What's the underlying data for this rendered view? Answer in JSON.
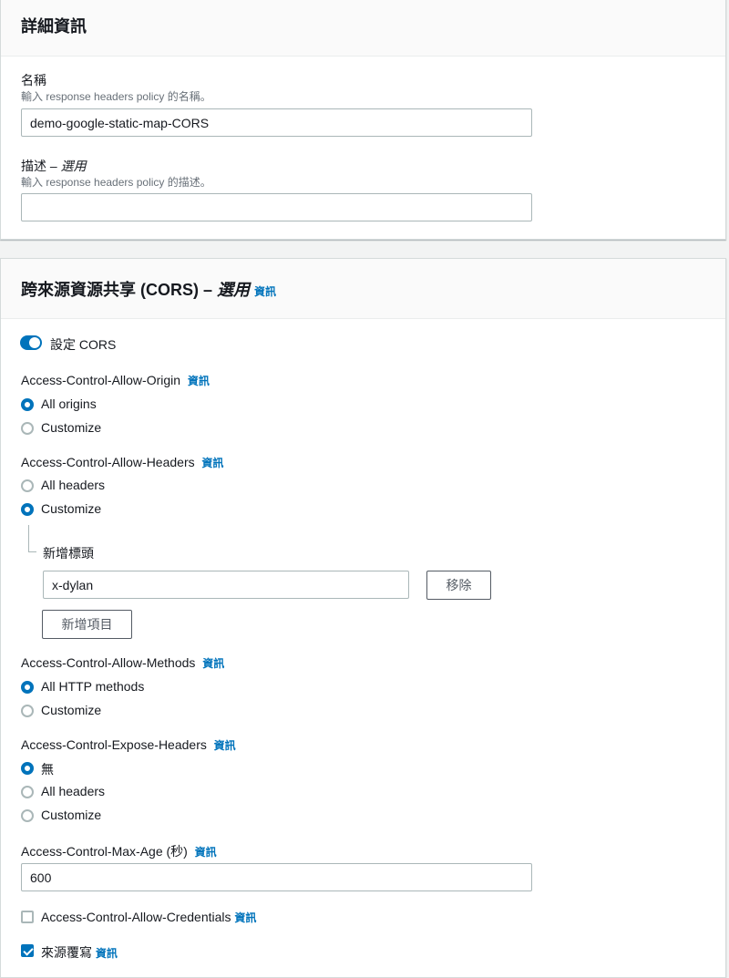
{
  "details": {
    "title": "詳細資訊",
    "name_label": "名稱",
    "name_desc": "輸入 response headers policy 的名稱。",
    "name_value": "demo-google-static-map-CORS",
    "desc_label": "描述 – ",
    "desc_optional": "選用",
    "desc_desc": "輸入 response headers policy 的描述。",
    "desc_value": ""
  },
  "cors": {
    "title": "跨來源資源共享 (CORS) – ",
    "title_optional": "選用",
    "info": "資訊",
    "toggle_label": "設定 CORS",
    "toggle_on": true,
    "allow_origin": {
      "label": "Access-Control-Allow-Origin",
      "options": [
        "All origins",
        "Customize"
      ],
      "selected": 0
    },
    "allow_headers": {
      "label": "Access-Control-Allow-Headers",
      "options": [
        "All headers",
        "Customize"
      ],
      "selected": 1,
      "sub_label": "新增標頭",
      "header_value": "x-dylan",
      "remove_label": "移除",
      "add_label": "新增項目"
    },
    "allow_methods": {
      "label": "Access-Control-Allow-Methods",
      "options": [
        "All HTTP methods",
        "Customize"
      ],
      "selected": 0
    },
    "expose_headers": {
      "label": "Access-Control-Expose-Headers",
      "options": [
        "無",
        "All headers",
        "Customize"
      ],
      "selected": 0
    },
    "max_age": {
      "label": "Access-Control-Max-Age (秒)",
      "value": "600"
    },
    "allow_credentials": {
      "label": "Access-Control-Allow-Credentials",
      "checked": false
    },
    "origin_override": {
      "label": "來源覆寫",
      "checked": true
    }
  },
  "colors": {
    "accent": "#0073bb",
    "text": "#16191f",
    "muted": "#687078",
    "border": "#aab7b8"
  }
}
